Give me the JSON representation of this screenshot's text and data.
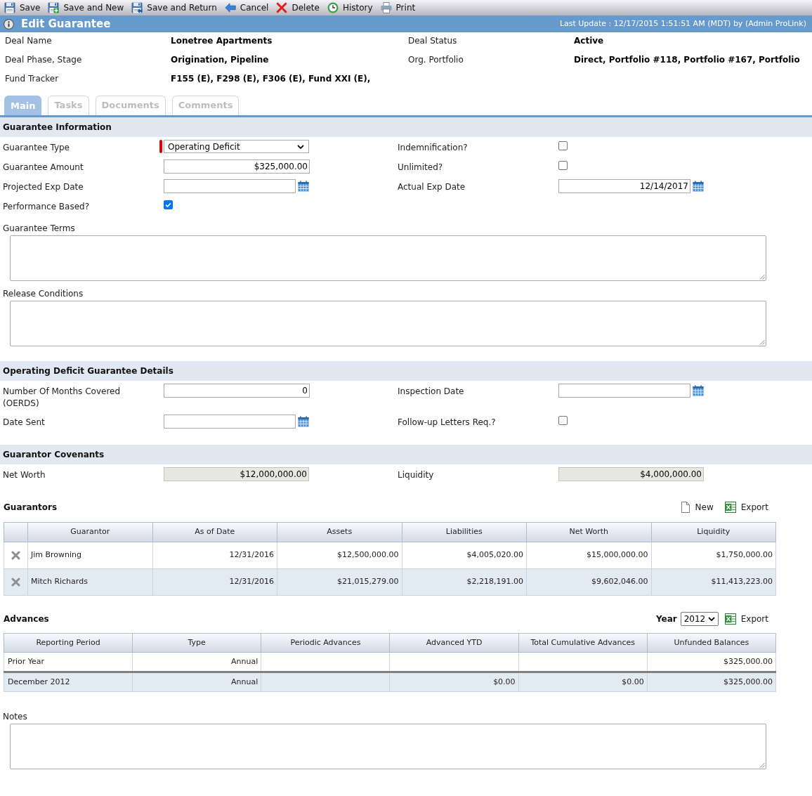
{
  "toolbar": [
    "Save",
    "Save and New",
    "Save and Return",
    "Cancel",
    "Delete",
    "History",
    "Print"
  ],
  "title_bar": {
    "title": "Edit Guarantee",
    "last_update": "Last Update : 12/17/2015 1:51:51 AM (MDT) by (Admin ProLink)"
  },
  "deal_info": [
    {
      "label": "Deal Name",
      "value": "Lonetree Apartments"
    },
    {
      "label": "Deal Status",
      "value": "Active"
    },
    {
      "label": "Deal Phase, Stage",
      "value": "Origination, Pipeline"
    },
    {
      "label": "Org. Portfolio",
      "value": "Direct, Portfolio #118, Portfolio #167, Portfolio"
    },
    {
      "label": "Fund Tracker",
      "value": "F155 (E), F298 (E), F306 (E), Fund XXI (E),"
    }
  ],
  "tabs": [
    {
      "label": "Main",
      "selected": true
    },
    {
      "label": "Tasks",
      "selected": false
    },
    {
      "label": "Documents",
      "selected": false
    },
    {
      "label": "Comments",
      "selected": false
    }
  ],
  "sections": [
    {
      "title": "Guarantee Information",
      "fields": [
        {
          "label": "Guarantee Type",
          "kind": "select",
          "value": "Operating Deficit",
          "required": true
        },
        {
          "label": "Indemnification?",
          "kind": "checkbox",
          "checked": false,
          "required": false
        },
        {
          "label": "Guarantee Amount",
          "kind": "text",
          "value": "$325,000.00",
          "required": false
        },
        {
          "label": "Unlimited?",
          "kind": "checkbox",
          "checked": false,
          "required": false
        },
        {
          "label": "Projected Exp Date",
          "kind": "date",
          "required": false
        },
        {
          "label": "Actual Exp Date",
          "kind": "date",
          "value": "12/14/2017",
          "required": false
        },
        {
          "label": "Performance Based?",
          "kind": "checkbox",
          "checked": true,
          "required": false
        }
      ],
      "text_areas": [
        {
          "label": "Guarantee Terms"
        },
        {
          "label": "Release Conditions"
        }
      ]
    },
    {
      "title": "Operating Deficit Guarantee Details",
      "fields": [
        {
          "label": "Number Of Months Covered (OERDS)",
          "kind": "text",
          "value": "0"
        },
        {
          "label": "Inspection Date",
          "kind": "date"
        },
        {
          "label": "Date Sent",
          "kind": "date"
        },
        {
          "label": "Follow-up Letters Req.?",
          "kind": "checkbox",
          "checked": false
        }
      ]
    },
    {
      "title": "Guarantor Covenants",
      "fields": [
        {
          "label": "Net Worth",
          "kind": "readonly",
          "value": "$12,000,000.00"
        },
        {
          "label": "Liquidity",
          "kind": "readonly",
          "value": "$4,000,000.00"
        }
      ]
    }
  ],
  "guarantors": {
    "title": "Guarantors",
    "actions": [
      "New",
      "Export"
    ],
    "columns": [
      "Guarantor",
      "As of Date",
      "Assets",
      "Liabilities",
      "Net Worth",
      "Liquidity"
    ],
    "rows": [
      [
        "Jim Browning",
        "12/31/2016",
        "$12,500,000.00",
        "$4,005,020.00",
        "$15,000,000.00",
        "$1,750,000.00"
      ],
      [
        "Mitch Richards",
        "12/31/2016",
        "$21,015,279.00",
        "$2,218,191.00",
        "$9,602,046.00",
        "$11,413,223.00"
      ]
    ]
  },
  "advances": {
    "title": "Advances",
    "year": {
      "label": "Year",
      "value": "2012"
    },
    "export": "Export",
    "columns": [
      "Reporting Period",
      "Type",
      "Periodic Advances",
      "Advanced YTD",
      "Total Cumulative Advances",
      "Unfunded Balances"
    ],
    "rows": [
      [
        "Prior Year",
        "Annual",
        null,
        null,
        null,
        "$325,000.00"
      ],
      [
        "December 2012",
        "Annual",
        null,
        "$0.00",
        "$0.00",
        "$325,000.00"
      ]
    ]
  },
  "notes": {
    "label": "Notes"
  }
}
